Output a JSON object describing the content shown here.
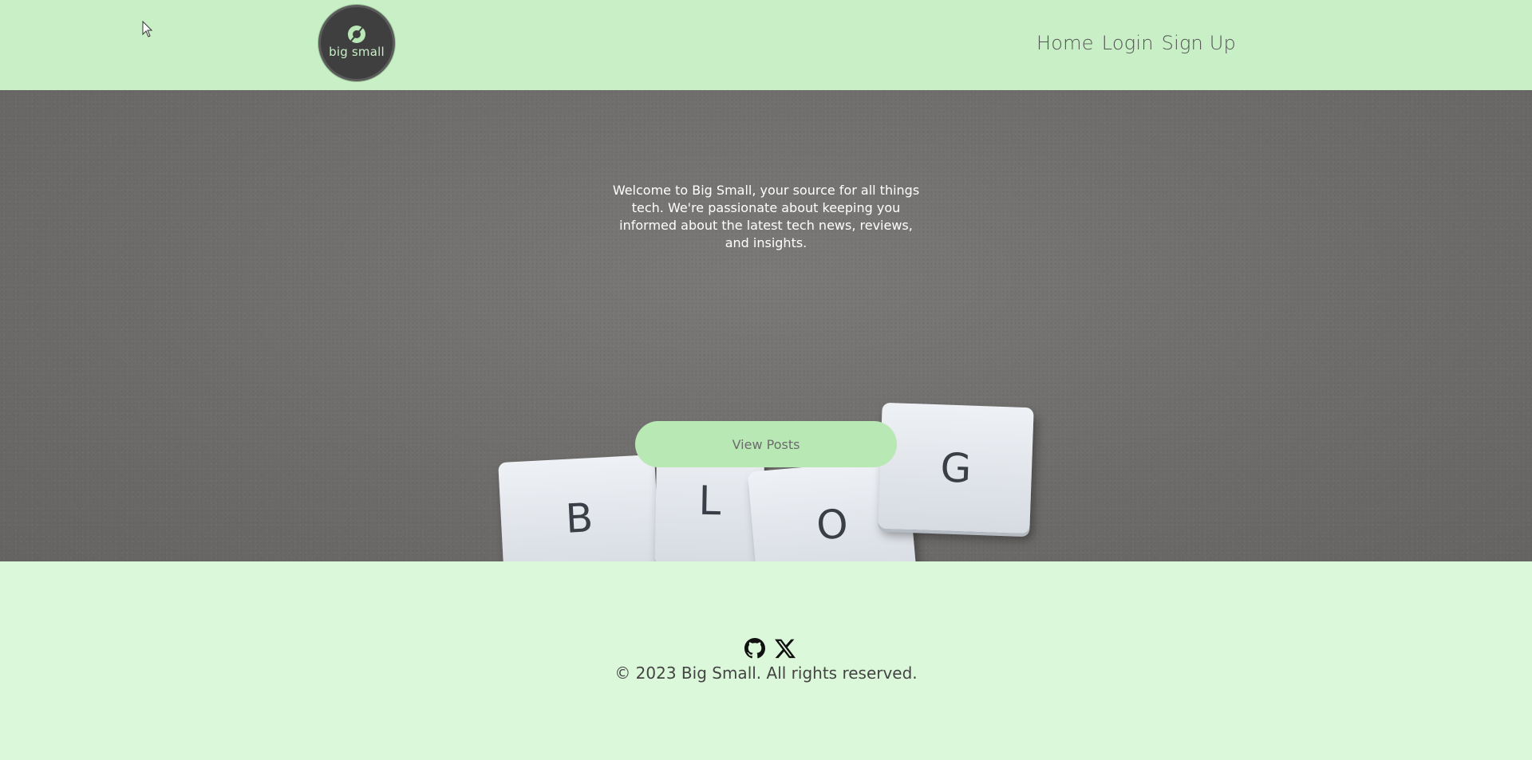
{
  "header": {
    "logo_text": "big small",
    "nav": {
      "home": "Home",
      "login": "Login",
      "signup": "Sign Up"
    }
  },
  "hero": {
    "intro": "Welcome to Big Small, your source for all things tech. We're passionate about keeping you informed about the latest tech news, reviews, and insights.",
    "cta_label": "View Posts",
    "keys": [
      "B",
      "L",
      "O",
      "G"
    ]
  },
  "footer": {
    "icons": [
      "github-icon",
      "x-icon"
    ],
    "copyright": "© 2023 Big Small. All rights reserved."
  }
}
